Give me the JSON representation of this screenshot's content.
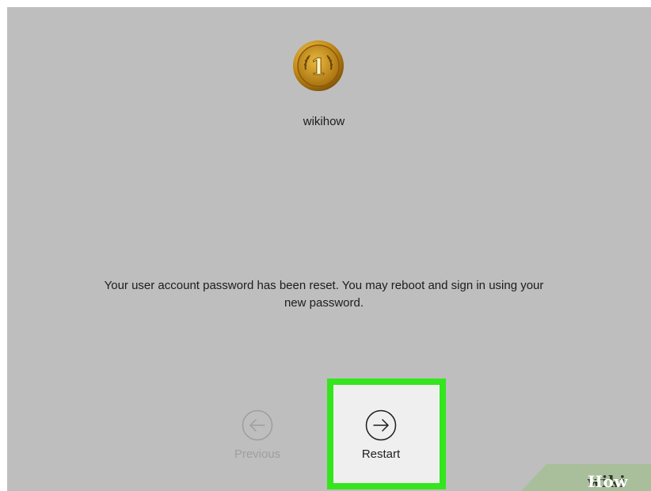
{
  "user": {
    "name": "wikihow",
    "avatar_icon": "gold-medal-icon"
  },
  "message": {
    "line1": "Your user account password has been reset. You may reboot and sign in using your",
    "line2": "new password."
  },
  "buttons": {
    "previous": {
      "label": "Previous",
      "icon": "left-arrow-icon",
      "enabled": false
    },
    "restart": {
      "label": "Restart",
      "icon": "right-arrow-icon",
      "enabled": true
    }
  },
  "highlight_color": "#35e51e",
  "background_color": "#bebebe",
  "watermark": {
    "part1": "wiki",
    "part2": "How"
  }
}
